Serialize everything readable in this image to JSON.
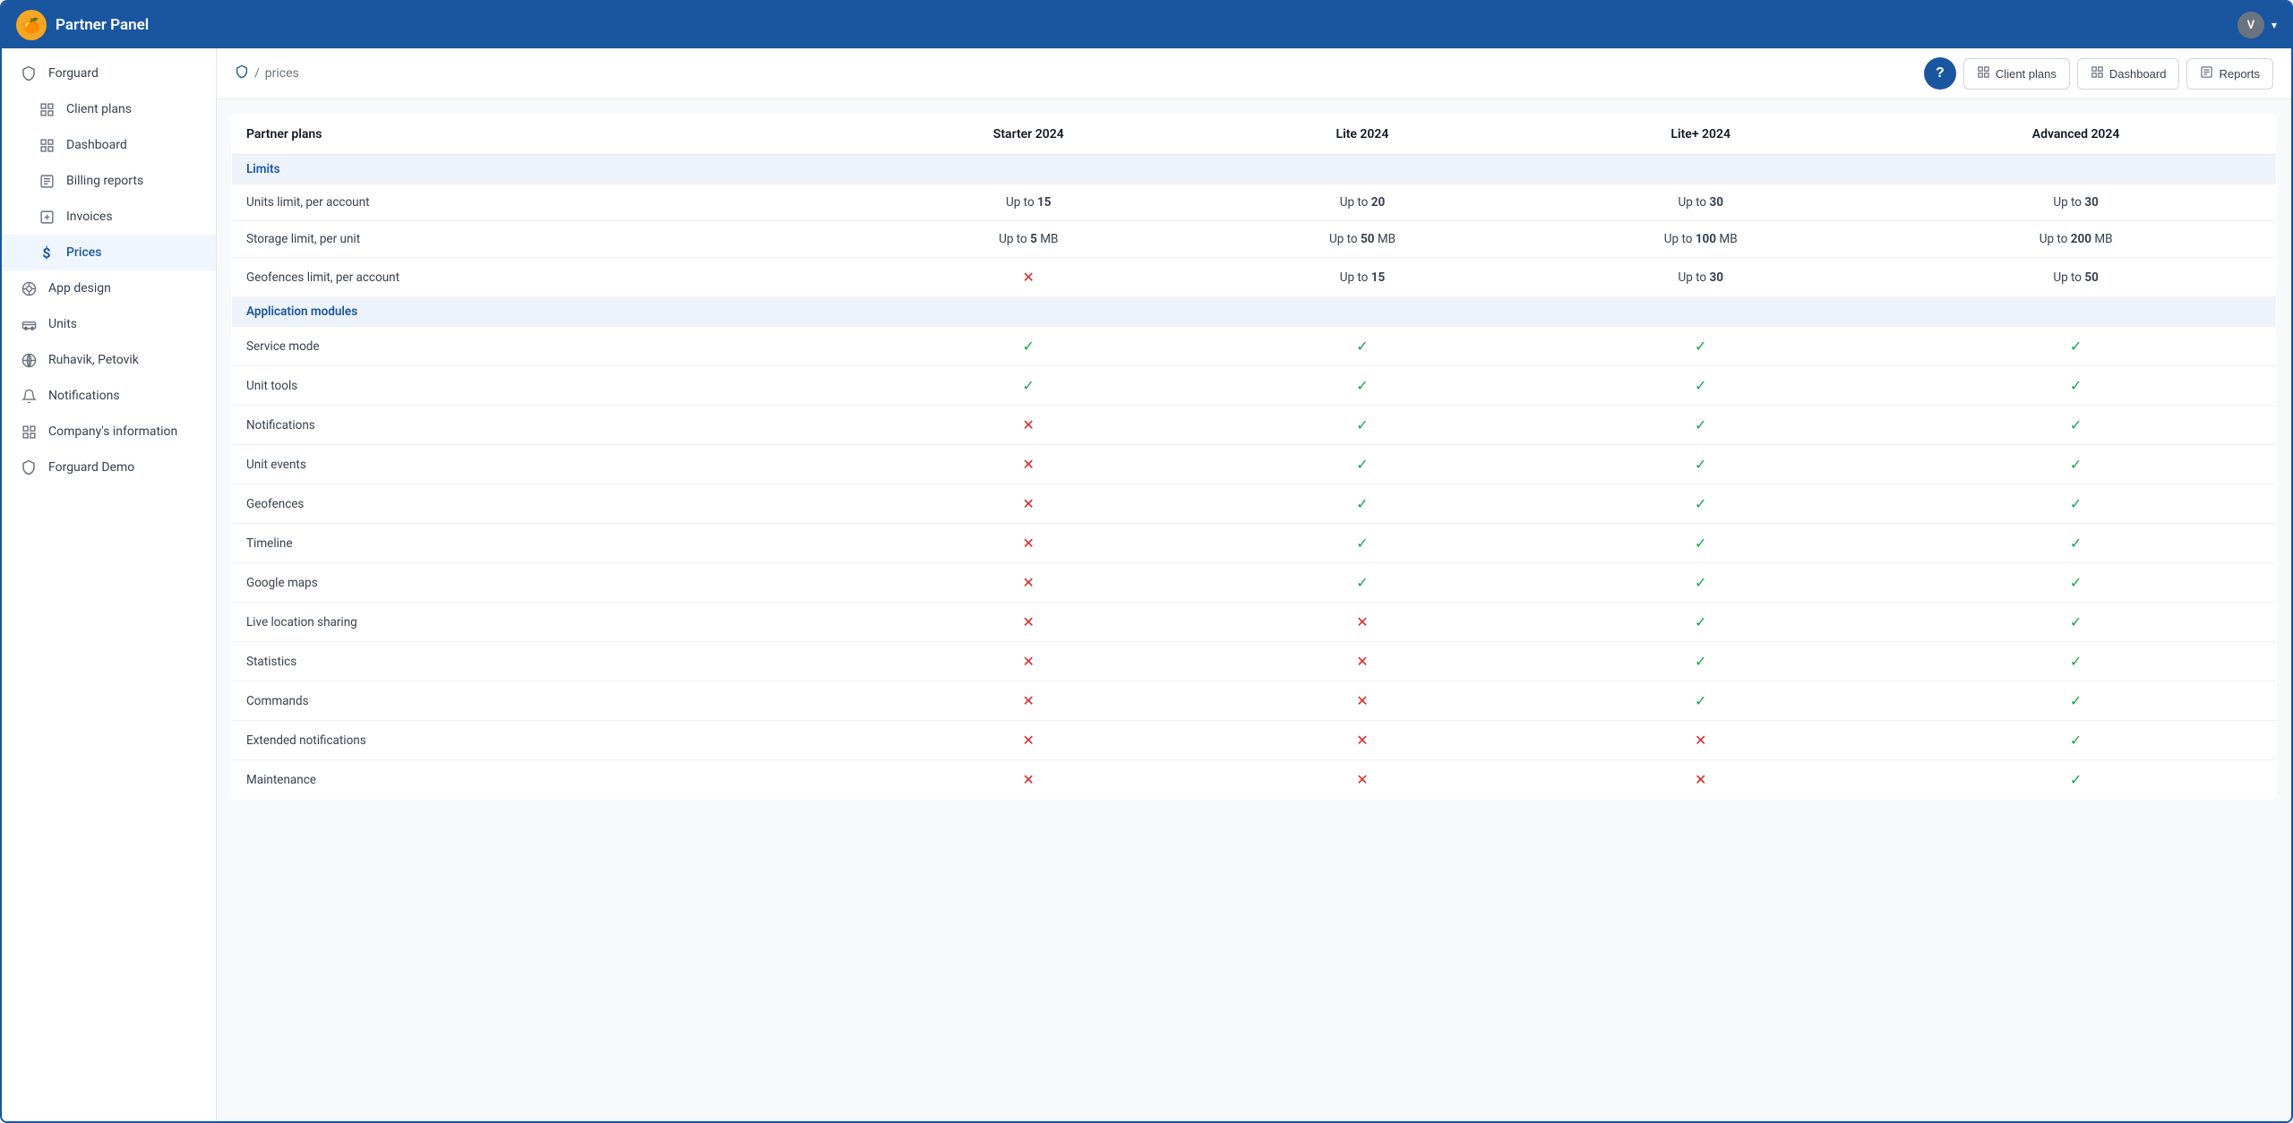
{
  "app": {
    "title": "Partner Panel",
    "logo_symbol": "🍊",
    "avatar_initial": "V"
  },
  "topbar": {
    "title": "Partner Panel"
  },
  "sidebar": {
    "items": [
      {
        "id": "forguard",
        "label": "Forguard",
        "icon": "🛡"
      },
      {
        "id": "client-plans",
        "label": "Client plans",
        "icon": "⊞",
        "indent": true
      },
      {
        "id": "dashboard",
        "label": "Dashboard",
        "icon": "▦",
        "indent": true
      },
      {
        "id": "billing-reports",
        "label": "Billing reports",
        "icon": "📋",
        "indent": true
      },
      {
        "id": "invoices",
        "label": "Invoices",
        "icon": "🪙",
        "indent": true
      },
      {
        "id": "prices",
        "label": "Prices",
        "icon": "$",
        "indent": true,
        "active": true
      },
      {
        "id": "app-design",
        "label": "App design",
        "icon": "🎨"
      },
      {
        "id": "units",
        "label": "Units",
        "icon": "🚗"
      },
      {
        "id": "ruhavik",
        "label": "Ruhavik, Petovik",
        "icon": "✳"
      },
      {
        "id": "notifications",
        "label": "Notifications",
        "icon": "🔔"
      },
      {
        "id": "company-info",
        "label": "Company's information",
        "icon": "▦"
      },
      {
        "id": "forguard-demo",
        "label": "Forguard Demo",
        "icon": "🛡"
      }
    ]
  },
  "breadcrumb": {
    "root_icon": "shield",
    "separator": "/",
    "current": "prices"
  },
  "action_buttons": [
    {
      "id": "client-plans-btn",
      "label": "Client plans",
      "icon": "⊞"
    },
    {
      "id": "dashboard-btn",
      "label": "Dashboard",
      "icon": "▦"
    },
    {
      "id": "reports-btn",
      "label": "Reports",
      "icon": "📋"
    }
  ],
  "table": {
    "columns": [
      {
        "id": "feature",
        "label": "Partner plans"
      },
      {
        "id": "starter",
        "label": "Starter 2024"
      },
      {
        "id": "lite",
        "label": "Lite 2024"
      },
      {
        "id": "lite-plus",
        "label": "Lite+ 2024"
      },
      {
        "id": "advanced",
        "label": "Advanced 2024"
      }
    ],
    "sections": [
      {
        "id": "limits",
        "label": "Limits",
        "rows": [
          {
            "feature": "Units limit, per account",
            "starter": {
              "text": "Up to ",
              "bold": "15"
            },
            "lite": {
              "text": "Up to ",
              "bold": "20"
            },
            "lite_plus": {
              "text": "Up to ",
              "bold": "30"
            },
            "advanced": {
              "text": "Up to ",
              "bold": "30"
            }
          },
          {
            "feature": "Storage limit, per unit",
            "starter": {
              "text": "Up to ",
              "bold": "5",
              "suffix": " MB"
            },
            "lite": {
              "text": "Up to ",
              "bold": "50",
              "suffix": " MB"
            },
            "lite_plus": {
              "text": "Up to ",
              "bold": "100",
              "suffix": " MB"
            },
            "advanced": {
              "text": "Up to ",
              "bold": "200",
              "suffix": " MB"
            }
          },
          {
            "feature": "Geofences limit, per account",
            "starter": {
              "type": "cross"
            },
            "lite": {
              "text": "Up to ",
              "bold": "15"
            },
            "lite_plus": {
              "text": "Up to ",
              "bold": "30"
            },
            "advanced": {
              "text": "Up to ",
              "bold": "50"
            }
          }
        ]
      },
      {
        "id": "app-modules",
        "label": "Application modules",
        "rows": [
          {
            "feature": "Service mode",
            "starter": {
              "type": "check"
            },
            "lite": {
              "type": "check"
            },
            "lite_plus": {
              "type": "check"
            },
            "advanced": {
              "type": "check"
            }
          },
          {
            "feature": "Unit tools",
            "starter": {
              "type": "check"
            },
            "lite": {
              "type": "check"
            },
            "lite_plus": {
              "type": "check"
            },
            "advanced": {
              "type": "check"
            }
          },
          {
            "feature": "Notifications",
            "starter": {
              "type": "cross"
            },
            "lite": {
              "type": "check"
            },
            "lite_plus": {
              "type": "check"
            },
            "advanced": {
              "type": "check"
            }
          },
          {
            "feature": "Unit events",
            "starter": {
              "type": "cross"
            },
            "lite": {
              "type": "check"
            },
            "lite_plus": {
              "type": "check"
            },
            "advanced": {
              "type": "check"
            }
          },
          {
            "feature": "Geofences",
            "starter": {
              "type": "cross"
            },
            "lite": {
              "type": "check"
            },
            "lite_plus": {
              "type": "check"
            },
            "advanced": {
              "type": "check"
            }
          },
          {
            "feature": "Timeline",
            "starter": {
              "type": "cross"
            },
            "lite": {
              "type": "check"
            },
            "lite_plus": {
              "type": "check"
            },
            "advanced": {
              "type": "check"
            }
          },
          {
            "feature": "Google maps",
            "starter": {
              "type": "cross"
            },
            "lite": {
              "type": "check"
            },
            "lite_plus": {
              "type": "check"
            },
            "advanced": {
              "type": "check"
            }
          },
          {
            "feature": "Live location sharing",
            "starter": {
              "type": "cross"
            },
            "lite": {
              "type": "cross"
            },
            "lite_plus": {
              "type": "check"
            },
            "advanced": {
              "type": "check"
            }
          },
          {
            "feature": "Statistics",
            "starter": {
              "type": "cross"
            },
            "lite": {
              "type": "cross"
            },
            "lite_plus": {
              "type": "check"
            },
            "advanced": {
              "type": "check"
            }
          },
          {
            "feature": "Commands",
            "starter": {
              "type": "cross"
            },
            "lite": {
              "type": "cross"
            },
            "lite_plus": {
              "type": "check"
            },
            "advanced": {
              "type": "check"
            }
          },
          {
            "feature": "Extended notifications",
            "starter": {
              "type": "cross"
            },
            "lite": {
              "type": "cross"
            },
            "lite_plus": {
              "type": "cross"
            },
            "advanced": {
              "type": "check"
            }
          },
          {
            "feature": "Maintenance",
            "starter": {
              "type": "cross"
            },
            "lite": {
              "type": "cross"
            },
            "lite_plus": {
              "type": "cross"
            },
            "advanced": {
              "type": "check"
            }
          }
        ]
      }
    ]
  }
}
